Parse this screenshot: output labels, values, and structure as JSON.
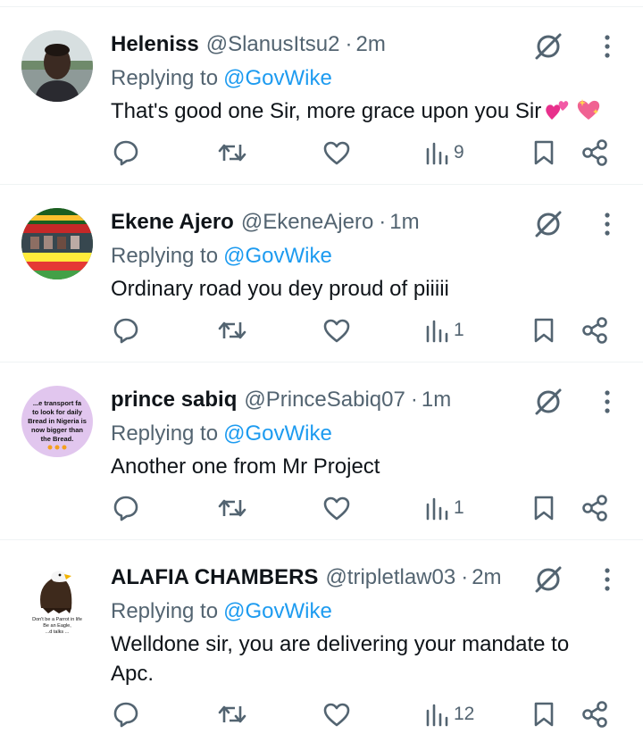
{
  "tweets": [
    {
      "display_name": "Heleniss",
      "handle": "@SlanusItsu2",
      "separator": "·",
      "time": "2m",
      "replying_prefix": "Replying to",
      "replying_to": "@GovWike",
      "text": "That's good one Sir, more grace upon you Sir",
      "emojis": [
        "two-hearts-emoji",
        "sparkling-heart-emoji"
      ],
      "views": "9",
      "avatar": "man-portrait-photo"
    },
    {
      "display_name": "Ekene Ajero",
      "handle": "@EkeneAjero",
      "separator": "·",
      "time": "1m",
      "replying_prefix": "Replying to",
      "replying_to": "@GovWike",
      "text": "Ordinary road you dey proud of piiiii",
      "views": "1",
      "avatar": "campaign-flyer-image"
    },
    {
      "display_name": "prince sabiq",
      "handle": "@PrinceSabiq07",
      "separator": "·",
      "time": "1m",
      "replying_prefix": "Replying to",
      "replying_to": "@GovWike",
      "text": "Another one from Mr Project",
      "views": "1",
      "avatar": "text-meme-image",
      "avatar_text": [
        "...e transport fa",
        "to look for daily",
        "Bread in Nigeria is",
        "now bigger than",
        "the Bread."
      ]
    },
    {
      "display_name": "ALAFIA CHAMBERS",
      "handle": "@tripletlaw03",
      "separator": "·",
      "time": "2m",
      "replying_prefix": "Replying to",
      "replying_to": "@GovWike",
      "text": "Welldone sir, you are delivering your mandate to Apc.",
      "views": "12",
      "avatar": "eagle-image",
      "avatar_text": [
        "Don't be a Parrot in life",
        "Be an Eagle,",
        "...d talks ..."
      ]
    }
  ],
  "colors": {
    "text_primary": "#0f1419",
    "text_secondary": "#536471",
    "link": "#1d9bf0",
    "divider": "#eff3f4"
  },
  "icons": {
    "reply": "reply-icon",
    "retweet": "retweet-icon",
    "like": "heart-icon",
    "views": "views-chart-icon",
    "bookmark": "bookmark-icon",
    "share": "share-icon",
    "grok": "grok-icon",
    "more": "more-options-icon"
  }
}
